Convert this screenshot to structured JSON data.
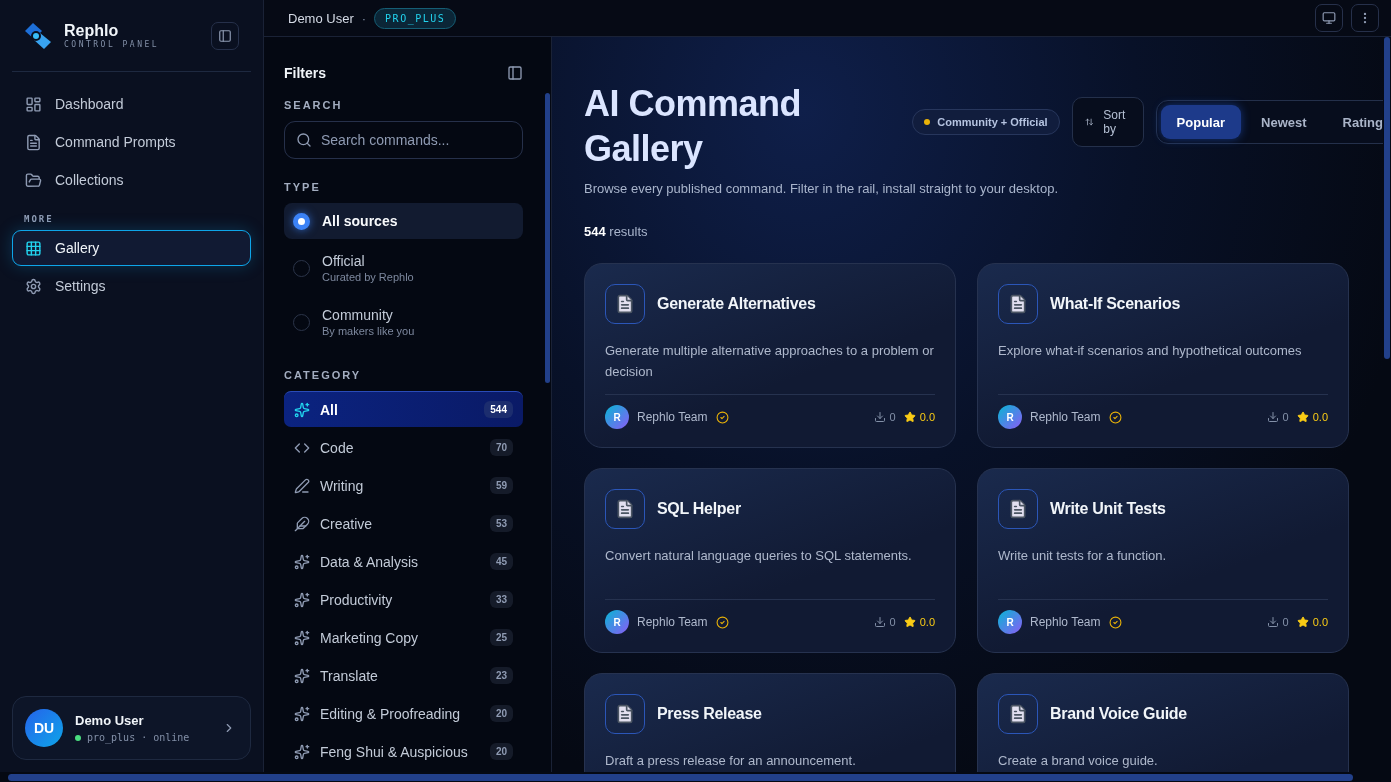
{
  "sidebar": {
    "brand": {
      "name": "Rephlo",
      "subtitle": "CONTROL PANEL"
    },
    "nav": [
      {
        "label": "Dashboard",
        "selected": false
      },
      {
        "label": "Command Prompts",
        "selected": false
      },
      {
        "label": "Collections",
        "selected": false
      }
    ],
    "more_label": "MORE",
    "more": [
      {
        "label": "Gallery",
        "selected": true
      },
      {
        "label": "Settings",
        "selected": false
      }
    ],
    "user": {
      "initials": "DU",
      "name": "Demo User",
      "status": "pro_plus · online",
      "online": true
    }
  },
  "header": {
    "user": "Demo User",
    "separator": "·",
    "plan": "PRO_PLUS"
  },
  "filters": {
    "title": "Filters",
    "search_label": "SEARCH",
    "search": {
      "placeholder": "Search commands..."
    },
    "type_label": "TYPE",
    "types": [
      {
        "label": "All sources",
        "selected": true
      },
      {
        "label": "Official",
        "sub": "Curated by Rephlo",
        "selected": false
      },
      {
        "label": "Community",
        "sub": "By makers like you",
        "selected": false
      }
    ],
    "category_label": "CATEGORY",
    "categories": [
      {
        "label": "All",
        "count": "544",
        "selected": true
      },
      {
        "label": "Code",
        "count": "70",
        "selected": false
      },
      {
        "label": "Writing",
        "count": "59",
        "selected": false
      },
      {
        "label": "Creative",
        "count": "53",
        "selected": false
      },
      {
        "label": "Data & Analysis",
        "count": "45",
        "selected": false
      },
      {
        "label": "Productivity",
        "count": "33",
        "selected": false
      },
      {
        "label": "Marketing Copy",
        "count": "25",
        "selected": false
      },
      {
        "label": "Translate",
        "count": "23",
        "selected": false
      },
      {
        "label": "Editing & Proofreading",
        "count": "20",
        "selected": false
      },
      {
        "label": "Feng Shui & Auspicious",
        "count": "20",
        "selected": false
      }
    ]
  },
  "main": {
    "title": "AI Command Gallery",
    "source_badge": {
      "label": "Community + Official",
      "color": "#eab308"
    },
    "sort_label": "Sort by",
    "sort_tabs": [
      {
        "label": "Popular",
        "selected": true
      },
      {
        "label": "Newest",
        "selected": false
      },
      {
        "label": "Rating",
        "selected": false
      }
    ],
    "subtitle": "Browse every published command. Filter in the rail, install straight to your desktop.",
    "results": "**544** results",
    "cards": [
      {
        "title": "Generate Alternatives",
        "description": "Generate multiple alternative approaches to a problem or decision",
        "author": "Rephlo Team",
        "author_initial": "R",
        "verified": true,
        "downloads": "0",
        "rating": "0.0"
      },
      {
        "title": "What-If Scenarios",
        "description": "Explore what-if scenarios and hypothetical outcomes",
        "author": "Rephlo Team",
        "author_initial": "R",
        "verified": true,
        "downloads": "0",
        "rating": "0.0"
      },
      {
        "title": "SQL Helper",
        "description": "Convert natural language queries to SQL statements.",
        "author": "Rephlo Team",
        "author_initial": "R",
        "verified": true,
        "downloads": "0",
        "rating": "0.0"
      },
      {
        "title": "Write Unit Tests",
        "description": "Write unit tests for a function.",
        "author": "Rephlo Team",
        "author_initial": "R",
        "verified": true,
        "downloads": "0",
        "rating": "0.0"
      },
      {
        "title": "Press Release",
        "description": "Draft a press release for an announcement."
      },
      {
        "title": "Brand Voice Guide",
        "description": "Create a brand voice guide."
      }
    ]
  }
}
